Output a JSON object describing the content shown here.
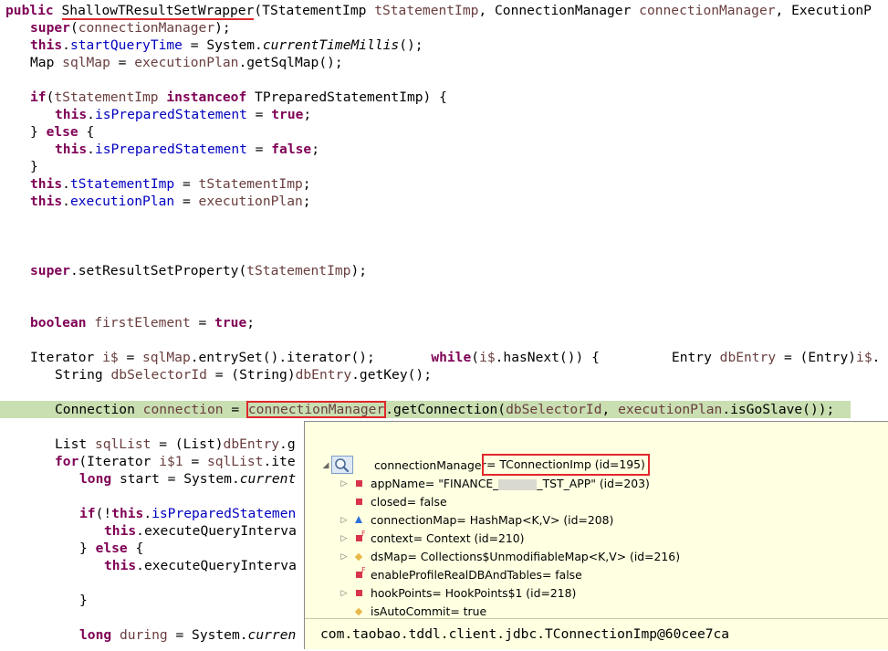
{
  "code": {
    "l1_kw": "public",
    "l1_class": "ShallowTResultSetWrapper",
    "l1_rest_a": "(TStatementImp ",
    "l1_p1": "tStatementImp",
    "l1_rest_b": ", ConnectionManager ",
    "l1_p2": "connectionManager",
    "l1_rest_c": ", ExecutionP",
    "l2_kw": "super",
    "l2_a": "(",
    "l2_p": "connectionManager",
    "l2_b": ");",
    "l3_kw": "this",
    "l3_a": ".",
    "l3_f": "startQueryTime",
    "l3_b": " = System.",
    "l3_m": "currentTimeMillis",
    "l3_c": "();",
    "l4_a": "Map ",
    "l4_v": "sqlMap",
    "l4_b": " = ",
    "l4_v2": "executionPlan",
    "l4_c": ".getSqlMap();",
    "l5_kw": "if",
    "l5_a": "(",
    "l5_v": "tStatementImp",
    "l5_kw2": " instanceof",
    "l5_b": " TPreparedStatementImp) {",
    "l6_kw": "this",
    "l6_a": ".",
    "l6_f": "isPreparedStatement",
    "l6_b": " = ",
    "l6_kw2": "true",
    "l6_c": ";",
    "l7_a": "} ",
    "l7_kw": "else",
    "l7_b": " {",
    "l8_kw": "this",
    "l8_a": ".",
    "l8_f": "isPreparedStatement",
    "l8_b": " = ",
    "l8_kw2": "false",
    "l8_c": ";",
    "l9": "}",
    "l10_kw": "this",
    "l10_a": ".",
    "l10_f": "tStatementImp",
    "l10_b": " = ",
    "l10_v": "tStatementImp",
    "l10_c": ";",
    "l11_kw": "this",
    "l11_a": ".",
    "l11_f": "executionPlan",
    "l11_b": " = ",
    "l11_v": "executionPlan",
    "l11_c": ";",
    "l12_kw": "super",
    "l12_a": ".setResultSetProperty(",
    "l12_v": "tStatementImp",
    "l12_b": ");",
    "l13_kw": "boolean",
    "l13_a": " ",
    "l13_v": "firstElement",
    "l13_b": " = ",
    "l13_kw2": "true",
    "l13_c": ";",
    "l14_a": "Iterator ",
    "l14_v": "i$",
    "l14_b": " = ",
    "l14_v2": "sqlMap",
    "l14_c": ".entrySet().iterator();       ",
    "l14_kw": "while",
    "l14_d": "(",
    "l14_v3": "i$",
    "l14_e": ".hasNext()) {         Entry ",
    "l14_v4": "dbEntry",
    "l14_f": " = (Entry)",
    "l14_v5": "i$",
    "l14_g": ".",
    "l15_a": "String ",
    "l15_v": "dbSelectorId",
    "l15_b": " = (String)",
    "l15_v2": "dbEntry",
    "l15_c": ".getKey();",
    "l16_a": "Connection ",
    "l16_v": "connection",
    "l16_b": " = ",
    "l16_v2": "connectionManager",
    "l16_c": ".getConnection(",
    "l16_v3": "dbSelectorId",
    "l16_d": ", ",
    "l16_v4": "executionPlan",
    "l16_e": ".isGoSlave());",
    "l17_a": "List ",
    "l17_v": "sqlList",
    "l17_b": " = (List)",
    "l17_v2": "dbEntry",
    "l17_c": ".g",
    "l18_kw": "for",
    "l18_a": "(Iterator ",
    "l18_v": "i$1",
    "l18_b": " = ",
    "l18_v2": "sqlList",
    "l18_c": ".ite",
    "l19_kw": "long",
    "l19_a": " start = System.",
    "l19_m": "current",
    "l20_kw": "if",
    "l20_a": "(!",
    "l20_kw2": "this",
    "l20_b": ".",
    "l20_f": "isPreparedStatemen",
    "l21_kw": "this",
    "l21_a": ".executeQueryInterva",
    "l22_a": "} ",
    "l22_kw": "else",
    "l22_b": " {",
    "l23_kw": "this",
    "l23_a": ".executeQueryInterva",
    "l24": "}",
    "l25_kw": "long",
    "l25_a": " ",
    "l25_v": "during",
    "l25_b": " = System.",
    "l25_m": "curren"
  },
  "popup": {
    "root_name": "connectionManager",
    "root_value": "= TConnectionImp  (id=195)",
    "rows": [
      {
        "text_a": "appName= \"FINANCE_",
        "text_b": "_TST_APP\" (id=203)"
      },
      {
        "text": "closed= false"
      },
      {
        "text": "connectionMap= HashMap<K,V>  (id=208)"
      },
      {
        "text": "context= Context  (id=210)"
      },
      {
        "text": "dsMap= Collections$UnmodifiableMap<K,V>  (id=216)"
      },
      {
        "text": "enableProfileRealDBAndTables= false"
      },
      {
        "text": "hookPoints= HookPoints$1  (id=218)"
      },
      {
        "text": "isAutoCommit= true"
      }
    ],
    "footer": "com.taobao.tddl.client.jdbc.TConnectionImp@60cee7ca"
  },
  "colors": {
    "keyword": "#7f0055",
    "field": "#0000c0",
    "variable": "#6a3e3e",
    "current_line": "#c9dfb2",
    "popup_bg": "#ffffe1",
    "highlight": "#e0282c"
  }
}
